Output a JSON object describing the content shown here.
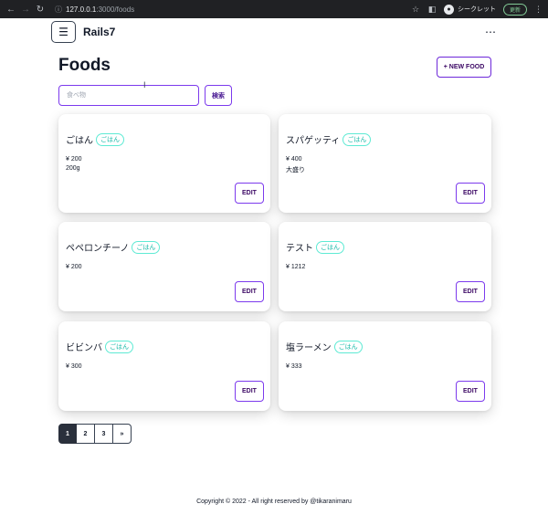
{
  "browser": {
    "url_host": "127.0.0.1",
    "url_path": ":3000/foods",
    "profile_label": "シークレット",
    "update_label": "更新"
  },
  "app": {
    "brand": "Rails7",
    "menu_icon": "☰",
    "more_icon": "⋯"
  },
  "page": {
    "title": "Foods",
    "new_button": "+ NEW FOOD"
  },
  "search": {
    "placeholder": "食べ物",
    "button": "検索"
  },
  "foods": [
    {
      "name": "ごはん",
      "category": "ごはん",
      "price": "¥ 200",
      "amount": "200g",
      "edit": "EDIT"
    },
    {
      "name": "スパゲッティ",
      "category": "ごはん",
      "price": "¥ 400",
      "amount": "大盛り",
      "edit": "EDIT"
    },
    {
      "name": "ペペロンチーノ",
      "category": "ごはん",
      "price": "¥ 200",
      "amount": "",
      "edit": "EDIT"
    },
    {
      "name": "テスト",
      "category": "ごはん",
      "price": "¥ 1212",
      "amount": "",
      "edit": "EDIT"
    },
    {
      "name": "ビビンバ",
      "category": "ごはん",
      "price": "¥ 300",
      "amount": "",
      "edit": "EDIT"
    },
    {
      "name": "塩ラーメン",
      "category": "ごはん",
      "price": "¥ 333",
      "amount": "",
      "edit": "EDIT"
    }
  ],
  "pagination": {
    "pages": [
      "1",
      "2",
      "3",
      "»"
    ],
    "current": "1"
  },
  "footer": {
    "text": "Copyright © 2022 - All right reserved by @tikaranimaru"
  }
}
